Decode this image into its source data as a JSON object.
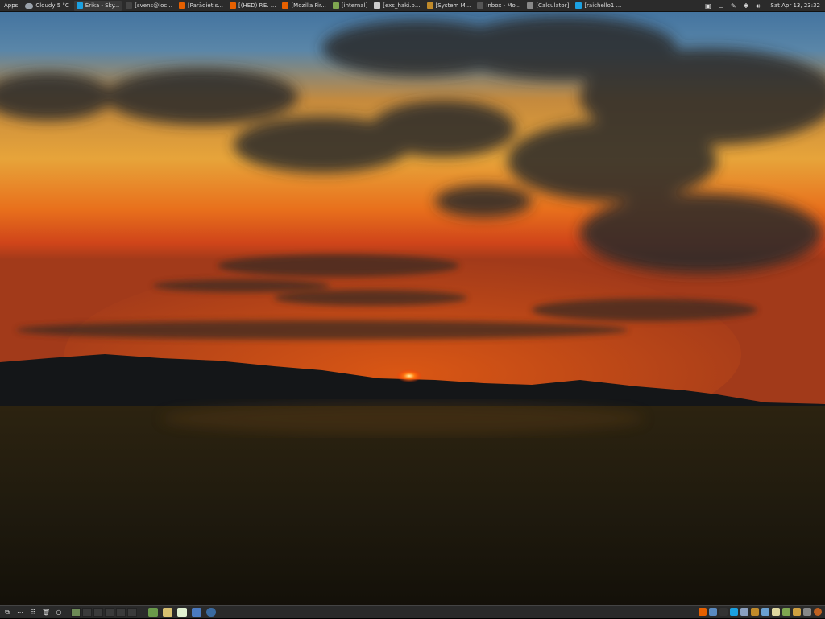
{
  "top_panel": {
    "apps_label": "Apps",
    "weather": "Cloudy 5 °C",
    "tasks": [
      {
        "label": "Érika - Sky...",
        "icon": "skype-icon",
        "color": "#1ba1e2"
      },
      {
        "label": "[svens@loc...",
        "icon": "terminal-icon",
        "color": "#444444"
      },
      {
        "label": "[Parādiet s...",
        "icon": "firefox-icon",
        "color": "#e66000"
      },
      {
        "label": "[(HED) P.E. ...",
        "icon": "firefox-icon",
        "color": "#e66000"
      },
      {
        "label": "[Mozilla Fir...",
        "icon": "firefox-icon",
        "color": "#e66000"
      },
      {
        "label": "[internal]",
        "icon": "folder-icon",
        "color": "#7fa650"
      },
      {
        "label": "[exs_haki.p...",
        "icon": "document-icon",
        "color": "#cccccc"
      },
      {
        "label": "[System M...",
        "icon": "system-monitor-icon",
        "color": "#c08a2a"
      },
      {
        "label": "Inbox - Mo...",
        "icon": "mail-icon",
        "color": "#555555"
      },
      {
        "label": "[Calculator]",
        "icon": "calculator-icon",
        "color": "#888888"
      },
      {
        "label": "[raichello1 ...",
        "icon": "skype-icon",
        "color": "#1ba1e2"
      }
    ],
    "clock": "Sat Apr 13, 23:32"
  },
  "bottom_panel": {
    "workspaces": 6,
    "active_workspace": 1
  },
  "colors": {
    "panel": "#2b2b2b",
    "accent": "#6d8a55"
  }
}
